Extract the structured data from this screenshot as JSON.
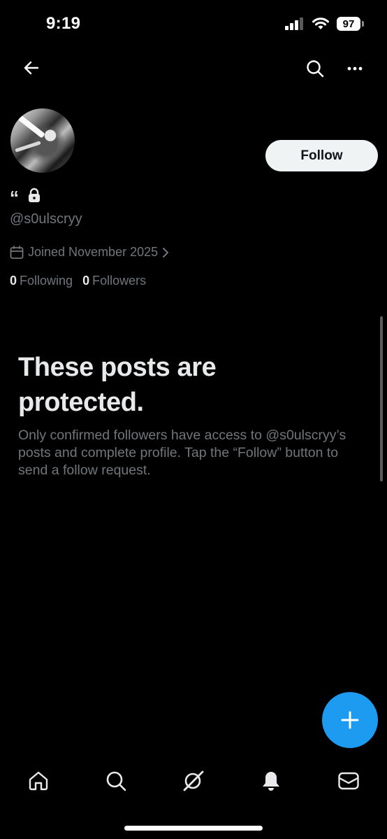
{
  "status_bar": {
    "time": "9:19",
    "battery": "97",
    "icons": [
      "signal-icon",
      "wifi-icon",
      "battery-icon"
    ]
  },
  "nav": {
    "back_icon": "back-arrow-icon",
    "search_icon": "search-icon",
    "more_icon": "more-icon"
  },
  "profile": {
    "follow_label": "Follow",
    "name_glyph": "“",
    "handle": "@s0ulscryy",
    "joined": "Joined November 2025",
    "following_count": "0",
    "following_label": "Following",
    "followers_count": "0",
    "followers_label": "Followers"
  },
  "protected": {
    "title": "These posts are protected.",
    "body": "Only confirmed followers have access to @s0ulscryy’s posts and complete profile. Tap the “Follow” button to send a follow request."
  },
  "tabbar": {
    "items": [
      "home-icon",
      "search-icon",
      "grok-icon",
      "notifications-icon",
      "messages-icon"
    ]
  },
  "colors": {
    "background": "#000000",
    "accent": "#1d9bf0",
    "text_primary": "#e7e9ea",
    "text_secondary": "#71767b"
  }
}
